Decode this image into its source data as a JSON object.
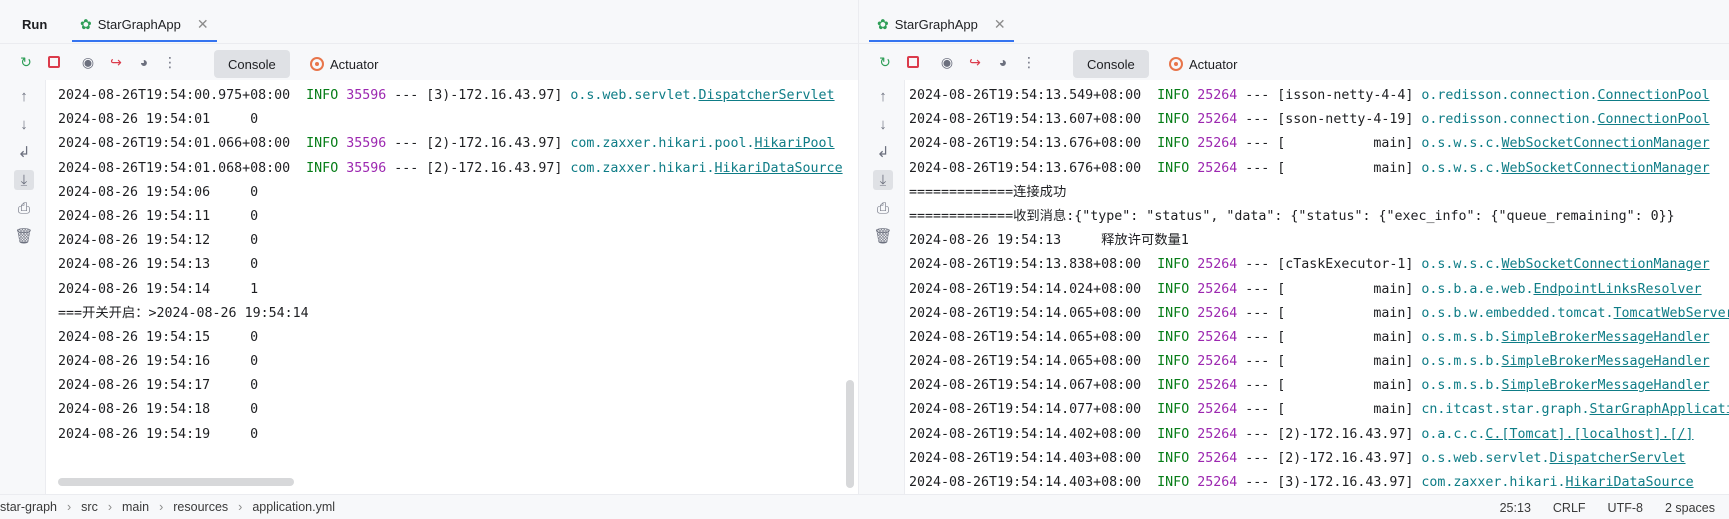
{
  "left": {
    "run_label": "Run",
    "tab_title": "StarGraphApp",
    "console_tab": "Console",
    "actuator_tab": "Actuator",
    "lines": [
      [
        {
          "t": "2024-08-26T19:54:00.975+08:00  ",
          "c": ""
        },
        {
          "t": "INFO",
          "c": "info"
        },
        {
          "t": " ",
          "c": ""
        },
        {
          "t": "35596",
          "c": "pid"
        },
        {
          "t": " --- [3)-172.16.43.97] ",
          "c": ""
        },
        {
          "t": "o.s.web.servlet.",
          "c": "logger"
        },
        {
          "t": "DispatcherServlet",
          "c": "logger ul"
        }
      ],
      [
        {
          "t": "2024-08-26 19:54:01     0",
          "c": ""
        }
      ],
      [
        {
          "t": "2024-08-26T19:54:01.066+08:00  ",
          "c": ""
        },
        {
          "t": "INFO",
          "c": "info"
        },
        {
          "t": " ",
          "c": ""
        },
        {
          "t": "35596",
          "c": "pid"
        },
        {
          "t": " --- [2)-172.16.43.97] ",
          "c": ""
        },
        {
          "t": "com.zaxxer.hikari.pool.",
          "c": "logger"
        },
        {
          "t": "HikariPool",
          "c": "logger ul"
        }
      ],
      [
        {
          "t": "2024-08-26T19:54:01.068+08:00  ",
          "c": ""
        },
        {
          "t": "INFO",
          "c": "info"
        },
        {
          "t": " ",
          "c": ""
        },
        {
          "t": "35596",
          "c": "pid"
        },
        {
          "t": " --- [2)-172.16.43.97] ",
          "c": ""
        },
        {
          "t": "com.zaxxer.hikari.",
          "c": "logger"
        },
        {
          "t": "HikariDataSource",
          "c": "logger ul"
        }
      ],
      [
        {
          "t": "2024-08-26 19:54:06     0",
          "c": ""
        }
      ],
      [
        {
          "t": "2024-08-26 19:54:11     0",
          "c": ""
        }
      ],
      [
        {
          "t": "2024-08-26 19:54:12     0",
          "c": ""
        }
      ],
      [
        {
          "t": "2024-08-26 19:54:13     0",
          "c": ""
        }
      ],
      [
        {
          "t": "2024-08-26 19:54:14     1",
          "c": ""
        }
      ],
      [
        {
          "t": "===开关开启：>2024-08-26 19:54:14",
          "c": ""
        }
      ],
      [
        {
          "t": "2024-08-26 19:54:15     0",
          "c": ""
        }
      ],
      [
        {
          "t": "2024-08-26 19:54:16     0",
          "c": ""
        }
      ],
      [
        {
          "t": "2024-08-26 19:54:17     0",
          "c": ""
        }
      ],
      [
        {
          "t": "2024-08-26 19:54:18     0",
          "c": ""
        }
      ],
      [
        {
          "t": "2024-08-26 19:54:19     0",
          "c": ""
        }
      ]
    ]
  },
  "right": {
    "tab_title": "StarGraphApp",
    "console_tab": "Console",
    "actuator_tab": "Actuator",
    "lines": [
      [
        {
          "t": "2024-08-26T19:54:13.549+08:00  ",
          "c": ""
        },
        {
          "t": "INFO",
          "c": "info"
        },
        {
          "t": " ",
          "c": ""
        },
        {
          "t": "25264",
          "c": "pid"
        },
        {
          "t": " --- [isson-netty-4-4] ",
          "c": ""
        },
        {
          "t": "o.redisson.connection.",
          "c": "logger"
        },
        {
          "t": "ConnectionPool",
          "c": "logger ul"
        }
      ],
      [
        {
          "t": "2024-08-26T19:54:13.607+08:00  ",
          "c": ""
        },
        {
          "t": "INFO",
          "c": "info"
        },
        {
          "t": " ",
          "c": ""
        },
        {
          "t": "25264",
          "c": "pid"
        },
        {
          "t": " --- [sson-netty-4-19] ",
          "c": ""
        },
        {
          "t": "o.redisson.connection.",
          "c": "logger"
        },
        {
          "t": "ConnectionPool",
          "c": "logger ul"
        }
      ],
      [
        {
          "t": "2024-08-26T19:54:13.676+08:00  ",
          "c": ""
        },
        {
          "t": "INFO",
          "c": "info"
        },
        {
          "t": " ",
          "c": ""
        },
        {
          "t": "25264",
          "c": "pid"
        },
        {
          "t": " --- [           main] ",
          "c": ""
        },
        {
          "t": "o.s.w.s.c.",
          "c": "logger"
        },
        {
          "t": "WebSocketConnectionManager",
          "c": "logger ul"
        }
      ],
      [
        {
          "t": "2024-08-26T19:54:13.676+08:00  ",
          "c": ""
        },
        {
          "t": "INFO",
          "c": "info"
        },
        {
          "t": " ",
          "c": ""
        },
        {
          "t": "25264",
          "c": "pid"
        },
        {
          "t": " --- [           main] ",
          "c": ""
        },
        {
          "t": "o.s.w.s.c.",
          "c": "logger"
        },
        {
          "t": "WebSocketConnectionManager",
          "c": "logger ul"
        }
      ],
      [
        {
          "t": "=============连接成功",
          "c": ""
        }
      ],
      [
        {
          "t": "=============收到消息:{\"type\": \"status\", \"data\": {\"status\": {\"exec_info\": {\"queue_remaining\": 0}}",
          "c": ""
        }
      ],
      [
        {
          "t": "2024-08-26 19:54:13     释放许可数量1",
          "c": ""
        }
      ],
      [
        {
          "t": "2024-08-26T19:54:13.838+08:00  ",
          "c": ""
        },
        {
          "t": "INFO",
          "c": "info"
        },
        {
          "t": " ",
          "c": ""
        },
        {
          "t": "25264",
          "c": "pid"
        },
        {
          "t": " --- [cTaskExecutor-1] ",
          "c": ""
        },
        {
          "t": "o.s.w.s.c.",
          "c": "logger"
        },
        {
          "t": "WebSocketConnectionManager",
          "c": "logger ul"
        }
      ],
      [
        {
          "t": "2024-08-26T19:54:14.024+08:00  ",
          "c": ""
        },
        {
          "t": "INFO",
          "c": "info"
        },
        {
          "t": " ",
          "c": ""
        },
        {
          "t": "25264",
          "c": "pid"
        },
        {
          "t": " --- [           main] ",
          "c": ""
        },
        {
          "t": "o.s.b.a.e.web.",
          "c": "logger"
        },
        {
          "t": "EndpointLinksResolver",
          "c": "logger ul"
        }
      ],
      [
        {
          "t": "2024-08-26T19:54:14.065+08:00  ",
          "c": ""
        },
        {
          "t": "INFO",
          "c": "info"
        },
        {
          "t": " ",
          "c": ""
        },
        {
          "t": "25264",
          "c": "pid"
        },
        {
          "t": " --- [           main] ",
          "c": ""
        },
        {
          "t": "o.s.b.w.embedded.tomcat.",
          "c": "logger"
        },
        {
          "t": "TomcatWebServer",
          "c": "logger ul"
        }
      ],
      [
        {
          "t": "2024-08-26T19:54:14.065+08:00  ",
          "c": ""
        },
        {
          "t": "INFO",
          "c": "info"
        },
        {
          "t": " ",
          "c": ""
        },
        {
          "t": "25264",
          "c": "pid"
        },
        {
          "t": " --- [           main] ",
          "c": ""
        },
        {
          "t": "o.s.m.s.b.",
          "c": "logger"
        },
        {
          "t": "SimpleBrokerMessageHandler",
          "c": "logger ul"
        }
      ],
      [
        {
          "t": "2024-08-26T19:54:14.065+08:00  ",
          "c": ""
        },
        {
          "t": "INFO",
          "c": "info"
        },
        {
          "t": " ",
          "c": ""
        },
        {
          "t": "25264",
          "c": "pid"
        },
        {
          "t": " --- [           main] ",
          "c": ""
        },
        {
          "t": "o.s.m.s.b.",
          "c": "logger"
        },
        {
          "t": "SimpleBrokerMessageHandler",
          "c": "logger ul"
        }
      ],
      [
        {
          "t": "2024-08-26T19:54:14.067+08:00  ",
          "c": ""
        },
        {
          "t": "INFO",
          "c": "info"
        },
        {
          "t": " ",
          "c": ""
        },
        {
          "t": "25264",
          "c": "pid"
        },
        {
          "t": " --- [           main] ",
          "c": ""
        },
        {
          "t": "o.s.m.s.b.",
          "c": "logger"
        },
        {
          "t": "SimpleBrokerMessageHandler",
          "c": "logger ul"
        }
      ],
      [
        {
          "t": "2024-08-26T19:54:14.077+08:00  ",
          "c": ""
        },
        {
          "t": "INFO",
          "c": "info"
        },
        {
          "t": " ",
          "c": ""
        },
        {
          "t": "25264",
          "c": "pid"
        },
        {
          "t": " --- [           main] ",
          "c": ""
        },
        {
          "t": "cn.itcast.star.graph.",
          "c": "logger"
        },
        {
          "t": "StarGraphApplication",
          "c": "logger ul"
        }
      ],
      [
        {
          "t": "2024-08-26T19:54:14.402+08:00  ",
          "c": ""
        },
        {
          "t": "INFO",
          "c": "info"
        },
        {
          "t": " ",
          "c": ""
        },
        {
          "t": "25264",
          "c": "pid"
        },
        {
          "t": " --- [2)-172.16.43.97] ",
          "c": ""
        },
        {
          "t": "o.a.c.c.",
          "c": "logger"
        },
        {
          "t": "C.[Tomcat].[localhost].[/]",
          "c": "logger ul"
        }
      ],
      [
        {
          "t": "2024-08-26T19:54:14.403+08:00  ",
          "c": ""
        },
        {
          "t": "INFO",
          "c": "info"
        },
        {
          "t": " ",
          "c": ""
        },
        {
          "t": "25264",
          "c": "pid"
        },
        {
          "t": " --- [2)-172.16.43.97] ",
          "c": ""
        },
        {
          "t": "o.s.web.servlet.",
          "c": "logger"
        },
        {
          "t": "DispatcherServlet",
          "c": "logger ul"
        }
      ],
      [
        {
          "t": "2024-08-26T19:54:14.403+08:00  ",
          "c": ""
        },
        {
          "t": "INFO",
          "c": "info"
        },
        {
          "t": " ",
          "c": ""
        },
        {
          "t": "25264",
          "c": "pid"
        },
        {
          "t": " --- [3)-172.16.43.97] ",
          "c": ""
        },
        {
          "t": "com.zaxxer.hikari.",
          "c": "logger"
        },
        {
          "t": "HikariDataSource",
          "c": "logger ul"
        }
      ]
    ]
  },
  "status": {
    "crumbs": [
      "star-graph",
      "src",
      "main",
      "resources",
      "application.yml"
    ],
    "position": "25:13",
    "line_ending": "CRLF",
    "encoding": "UTF-8",
    "indent": "2 spaces"
  },
  "icons": {
    "rerun": "rerun-icon",
    "stop": "stop-icon",
    "camera": "screenshot-icon",
    "exit": "exit-icon",
    "gauge": "gauge-icon",
    "more": "more-icon"
  }
}
